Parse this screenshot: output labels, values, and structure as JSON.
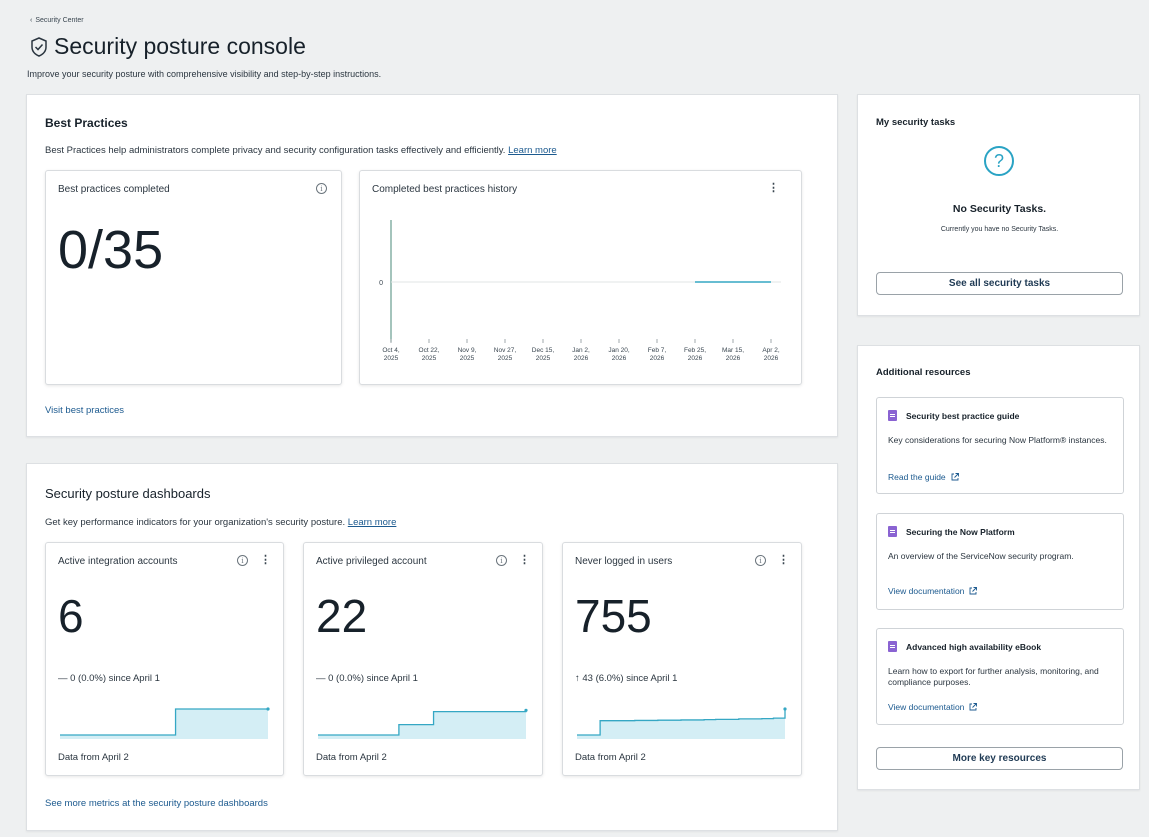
{
  "breadcrumb": {
    "label": "Security Center"
  },
  "header": {
    "title": "Security posture console",
    "subtitle": "Improve your security posture with comprehensive visibility and step-by-step instructions."
  },
  "best_practices": {
    "title": "Best Practices",
    "description": "Best Practices help administrators complete privacy and security configuration tasks effectively and efficiently.",
    "learn_more": "Learn more",
    "completed_label": "Best practices completed",
    "completed_value": "0/35",
    "visit_link": "Visit best practices",
    "history": {
      "title": "Completed best practices history"
    }
  },
  "chart_data": {
    "type": "line",
    "title": "Completed best practices history",
    "x": [
      "Oct 4, 2025",
      "Oct 22, 2025",
      "Nov 9, 2025",
      "Nov 27, 2025",
      "Dec 15, 2025",
      "Jan 2, 2026",
      "Jan 20, 2026",
      "Feb 7, 2026",
      "Feb 25, 2026",
      "Mar 15, 2026",
      "Apr 2, 2026"
    ],
    "x_labels": [
      {
        "month": "Oct 4,",
        "year": "2025"
      },
      {
        "month": "Oct 22,",
        "year": "2025"
      },
      {
        "month": "Nov 9,",
        "year": "2025"
      },
      {
        "month": "Nov 27,",
        "year": "2025"
      },
      {
        "month": "Dec 15,",
        "year": "2025"
      },
      {
        "month": "Jan 2,",
        "year": "2026"
      },
      {
        "month": "Jan 20,",
        "year": "2026"
      },
      {
        "month": "Feb 7,",
        "year": "2026"
      },
      {
        "month": "Feb 25,",
        "year": "2026"
      },
      {
        "month": "Mar 15,",
        "year": "2026"
      },
      {
        "month": "Apr 2,",
        "year": "2026"
      }
    ],
    "yticks": [
      "0"
    ],
    "series": [
      {
        "points": [
          [
            "Feb 25, 2026",
            0
          ],
          [
            "Apr 2, 2026",
            0
          ]
        ]
      }
    ],
    "color": "#35a7c4"
  },
  "dashboards": {
    "title": "Security posture dashboards",
    "description": "Get key performance indicators for your organization's security posture.",
    "learn_more": "Learn more",
    "see_more": "See more metrics at the security posture dashboards",
    "kpis": [
      {
        "label": "Active integration accounts",
        "value": "6",
        "delta": "— 0 (0.0%) since April 1",
        "footer": "Data from April 2",
        "trend": [
          0,
          0,
          0,
          0,
          0,
          0,
          0,
          0,
          0,
          0,
          1,
          1,
          1,
          1,
          1,
          1,
          1,
          1,
          1
        ]
      },
      {
        "label": "Active privileged account",
        "value": "22",
        "delta": "— 0 (0.0%) since April 1",
        "footer": "Data from April 2",
        "trend": [
          0,
          0,
          0,
          0,
          0,
          0,
          0,
          0.4,
          0.4,
          0.4,
          0.9,
          0.9,
          0.9,
          0.9,
          0.9,
          0.9,
          0.9,
          0.9,
          0.95
        ]
      },
      {
        "label": "Never logged in users",
        "value": "755",
        "delta": "↑ 43 (6.0%) since April 1",
        "footer": "Data from April 2",
        "trend": [
          0,
          0,
          0.55,
          0.55,
          0.55,
          0.56,
          0.56,
          0.57,
          0.57,
          0.58,
          0.58,
          0.59,
          0.6,
          0.6,
          0.62,
          0.62,
          0.63,
          0.65,
          1
        ]
      }
    ]
  },
  "tasks": {
    "title": "My security tasks",
    "empty_title": "No Security Tasks.",
    "empty_text": "Currently you have no Security Tasks.",
    "button": "See all security tasks"
  },
  "resources": {
    "title": "Additional resources",
    "items": [
      {
        "title": "Security best practice guide",
        "body": "Key considerations for securing Now Platform® instances.",
        "link": "Read the guide"
      },
      {
        "title": "Securing the Now Platform",
        "body": "An overview of the ServiceNow security program.",
        "link": "View documentation"
      },
      {
        "title": "Advanced high availability eBook",
        "body": "Learn how to export for further analysis, monitoring, and compliance purposes.",
        "link": "View documentation"
      }
    ],
    "button": "More key resources"
  },
  "colors": {
    "accent": "#1c5a8f",
    "chart": "#35a7c4",
    "chart_fill": "#d4eef5",
    "doc_icon": "#8a63d2"
  }
}
